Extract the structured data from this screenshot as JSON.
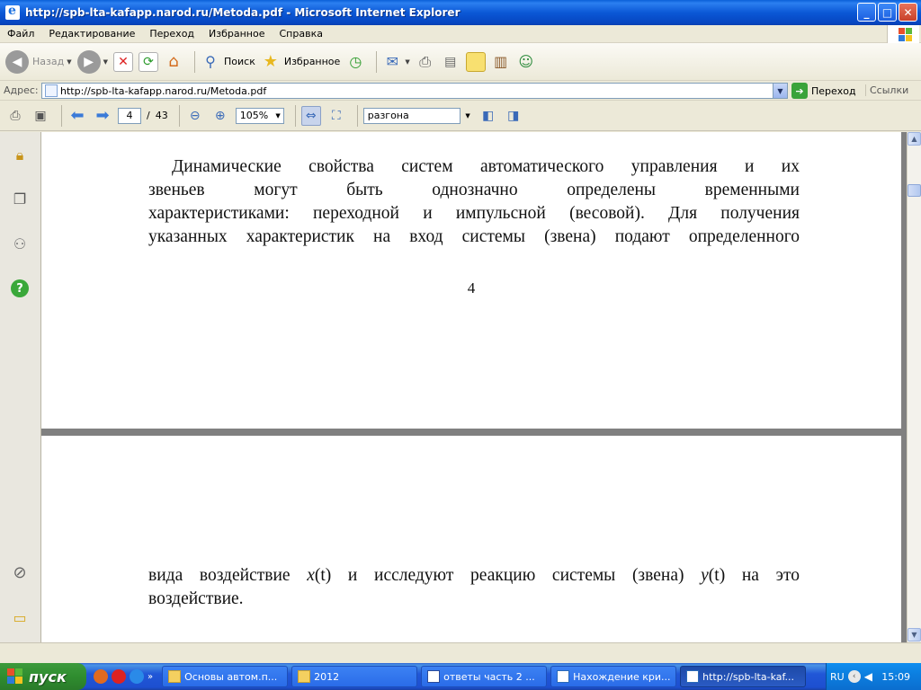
{
  "window": {
    "title": "http://spb-lta-kafapp.narod.ru/Metoda.pdf - Microsoft Internet Explorer",
    "minimize": "_",
    "maximize": "□",
    "close": "✕"
  },
  "menu": [
    "Файл",
    "Редактирование",
    "Переход",
    "Избранное",
    "Справка"
  ],
  "toolbar": {
    "back_label": "Назад",
    "search_label": "Поиск",
    "favorites_label": "Избранное"
  },
  "address": {
    "label": "Адрес:",
    "url": "http://spb-lta-kafapp.narod.ru/Metoda.pdf",
    "go_label": "Переход",
    "links_label": "Ссылки"
  },
  "reader": {
    "current_page": "4",
    "page_separator": "/",
    "total_pages": "43",
    "zoom": "105%",
    "search_value": "разгона"
  },
  "document": {
    "page1_lines": [
      "Динамические свойства систем автоматического управления и их",
      "звеньев могут быть однозначно определены временными",
      "характеристиками: переходной и импульсной (весовой). Для получения",
      "указанных характеристик на вход системы (звена) подают определенного"
    ],
    "page_number": "4",
    "page2_line1_a": "вида воздействие ",
    "page2_var_x": "x",
    "page2_line1_b": "(t) и исследуют реакцию системы (звена) ",
    "page2_var_y": "y",
    "page2_line1_c": "(t) на это",
    "page2_line2": "воздействие."
  },
  "taskbar": {
    "start_label": "пуск",
    "tasks": [
      "Основы автом.п...",
      "2012",
      "ответы часть 2 ...",
      "Нахождение кри...",
      "http://spb-lta-kaf..."
    ],
    "language": "RU",
    "clock": "15:09"
  }
}
